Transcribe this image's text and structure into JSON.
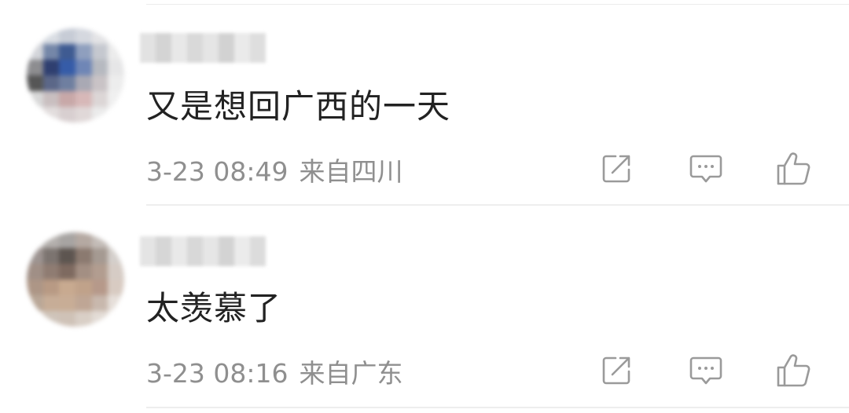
{
  "comments": [
    {
      "text": "又是想回广西的一天",
      "time": "3-23 08:49",
      "location": "来自四川",
      "avatar_colors": [
        "#e9e9ea",
        "#d9dde3",
        "#c7ccd6",
        "#d5d8df",
        "#e4e4e6",
        "#f2f2f2",
        "#d3d5da",
        "#7587a8",
        "#3f5b92",
        "#8f9fbe",
        "#c5c8cf",
        "#ececec",
        "#8d8d90",
        "#2f3f70",
        "#365ca8",
        "#6f86b6",
        "#b6b9c0",
        "#e6e6e7",
        "#565656",
        "#5b6788",
        "#6f7fa0",
        "#a9a9b4",
        "#c9c3c6",
        "#ededed",
        "#d8d8d8",
        "#c9bfc0",
        "#c8a8a8",
        "#d7b8b8",
        "#dcd6d6",
        "#f0f0f0",
        "#efefef",
        "#e2dddd",
        "#d8cfd0",
        "#e0d8d8",
        "#ebebeb",
        "#f6f6f6"
      ],
      "username_colors": [
        "#e2e2e2",
        "#d4d4d4",
        "#e8e8e8",
        "#d9d9d9",
        "#e5e5e5",
        "#d2d2d2",
        "#eaeaea",
        "#dedede"
      ]
    },
    {
      "text": "太羡慕了",
      "time": "3-23 08:16",
      "location": "来自广东",
      "avatar_colors": [
        "#c6c2c0",
        "#b4b0ad",
        "#a7a4a2",
        "#b5a9a2",
        "#c4bdb8",
        "#e0dddb",
        "#9d9491",
        "#7c7470",
        "#5d5550",
        "#8b7a70",
        "#a59a92",
        "#d4cfcb",
        "#a08f86",
        "#8f7c72",
        "#7e6a60",
        "#a38f83",
        "#b29d90",
        "#d6ccc5",
        "#ad9686",
        "#b89a84",
        "#c8aa90",
        "#c0a28a",
        "#b6998a",
        "#d8cbc2",
        "#b9a797",
        "#c7ad97",
        "#c8ad96",
        "#bfa695",
        "#c8b8ad",
        "#e6dfda",
        "#ddd6d0",
        "#cfc4ba",
        "#cfc2b7",
        "#d9cfc6",
        "#e3dcd6",
        "#f1eeeb"
      ],
      "username_colors": [
        "#e4e4e4",
        "#d6d6d6",
        "#e9e9e9",
        "#d8d8d8",
        "#e6e6e6",
        "#d3d3d3",
        "#ebebeb",
        "#dcdcdc"
      ]
    }
  ],
  "actions": {
    "share_icon": "share-icon",
    "reply_icon": "comment-icon",
    "like_icon": "thumbs-up-icon"
  },
  "colors": {
    "text": "#222222",
    "meta": "#8f8f8f",
    "icon": "#9a9a9a",
    "divider": "#eeeeee"
  }
}
